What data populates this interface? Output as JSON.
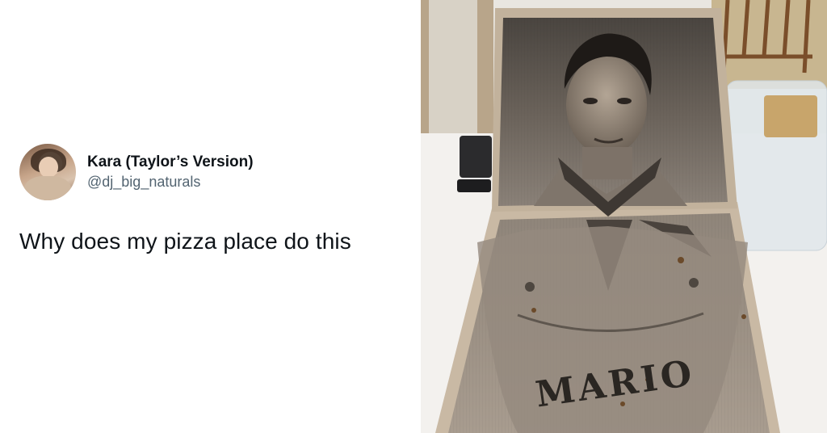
{
  "tweet": {
    "display_name": "Kara (Taylor’s Version)",
    "handle": "@dj_big_naturals",
    "text": "Why does my pizza place do this"
  },
  "photo": {
    "printed_text": "MARIO",
    "description_icon": "pizza-box-photo"
  },
  "colors": {
    "text_primary": "#0f1419",
    "text_secondary": "#536471",
    "background": "#ffffff"
  }
}
